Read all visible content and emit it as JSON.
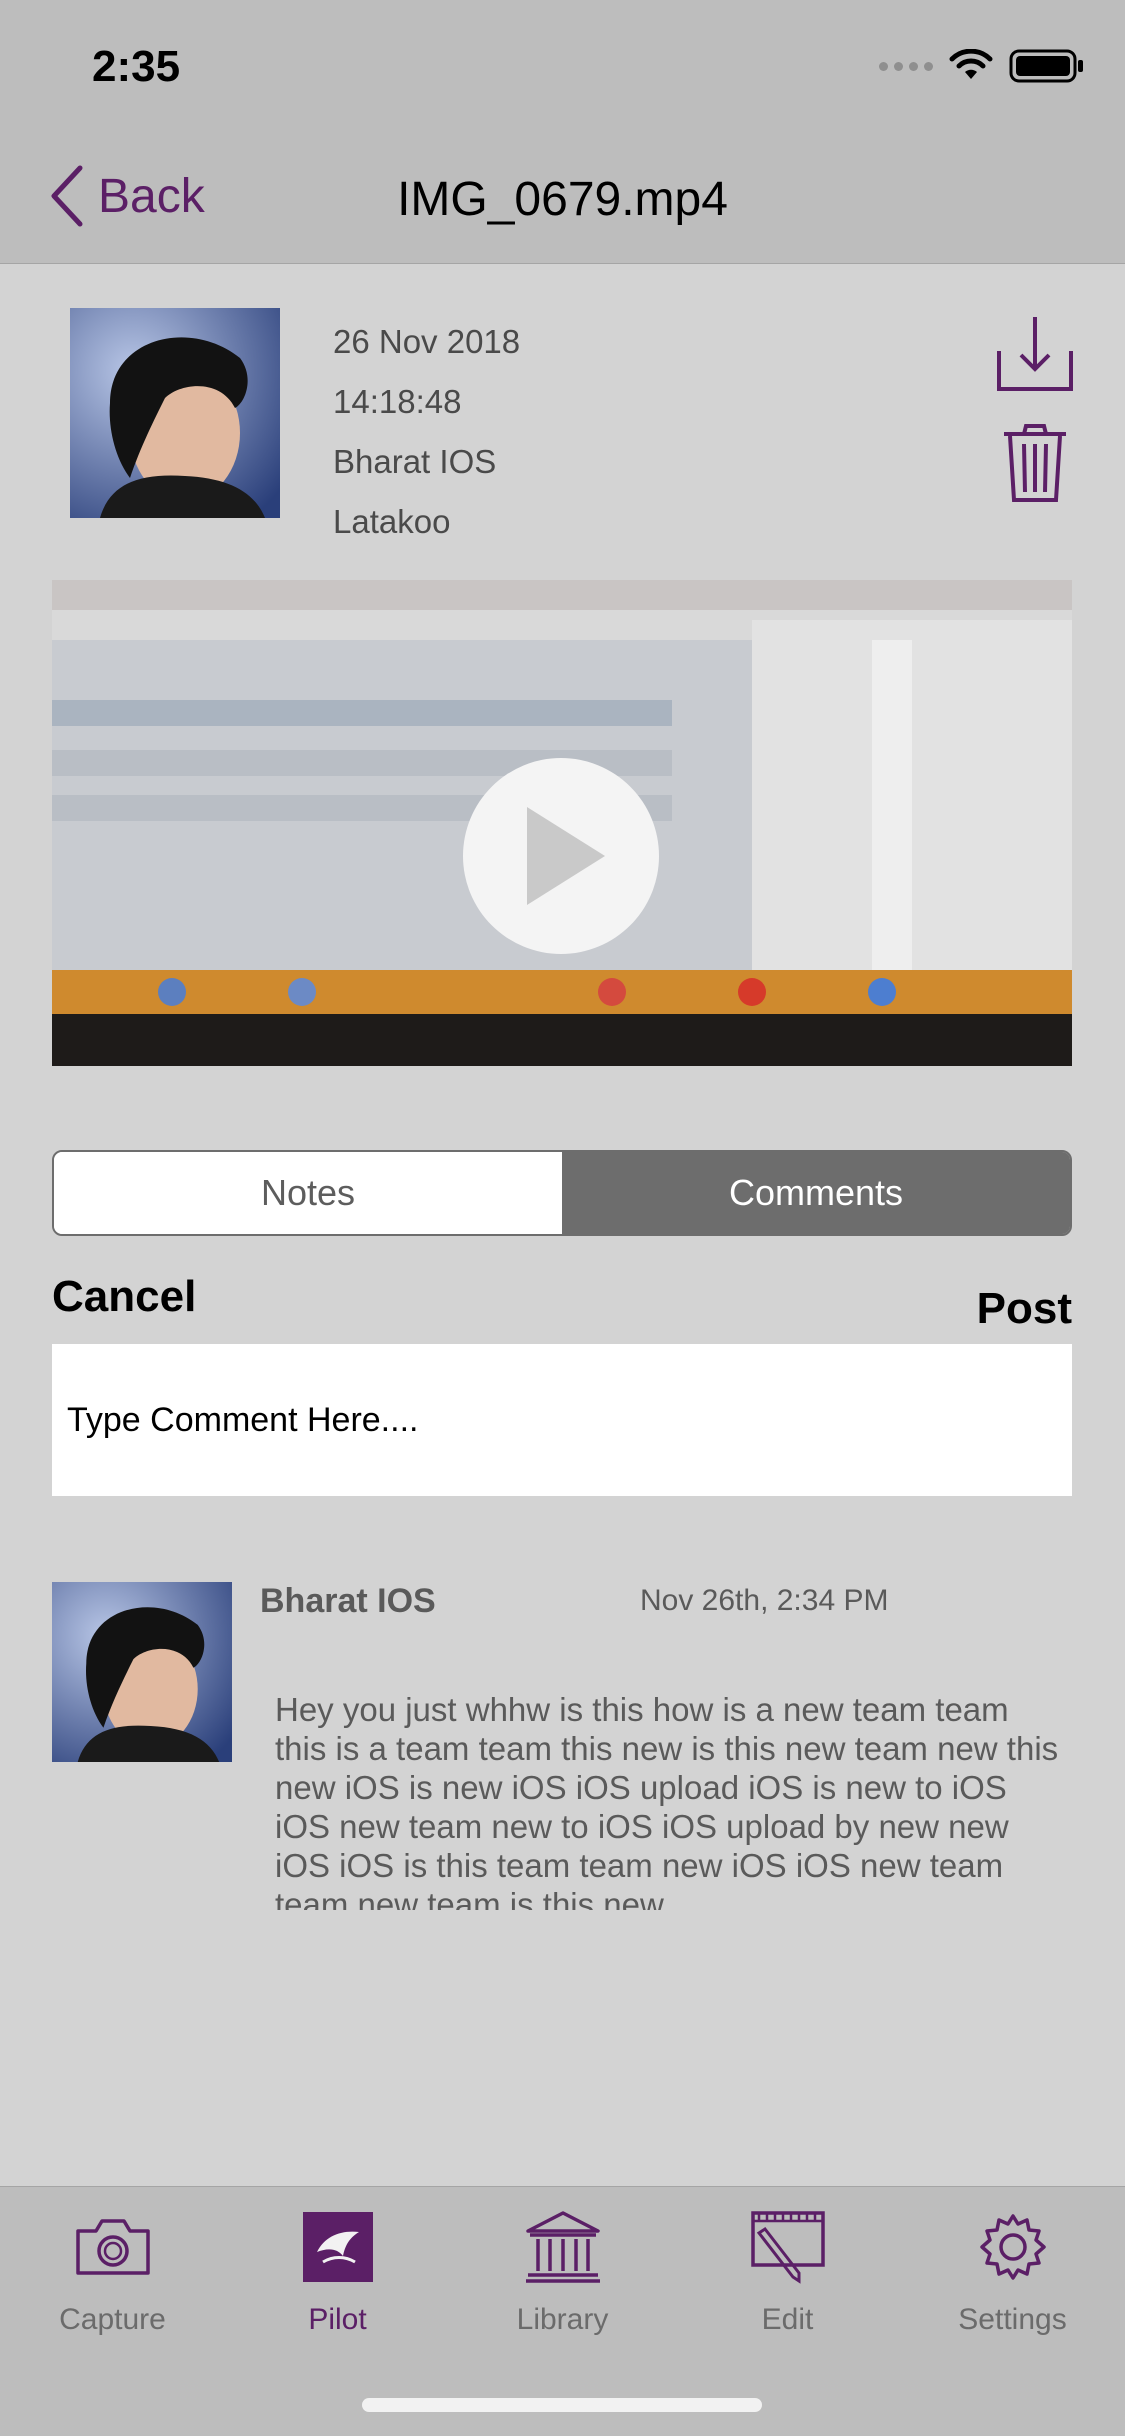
{
  "status_bar": {
    "time": "2:35"
  },
  "nav": {
    "back_label": "Back",
    "title": "IMG_0679.mp4"
  },
  "media_info": {
    "date": "26 Nov 2018",
    "time": "14:18:48",
    "author": "Bharat IOS",
    "organization": "Latakoo"
  },
  "tabs": {
    "notes": "Notes",
    "comments": "Comments",
    "selected": "comments"
  },
  "composer": {
    "cancel_label": "Cancel",
    "post_label": "Post",
    "placeholder": "Type Comment Here...."
  },
  "comments": [
    {
      "author": "Bharat IOS",
      "timestamp": "Nov 26th, 2:34 PM",
      "text": "Hey you just whhw is this how is a new team team this is a team team this new is this new team new this new iOS is new iOS iOS upload iOS is new to iOS iOS new team new to iOS iOS upload by new new iOS iOS is this team team new iOS iOS new team team new team is this new"
    }
  ],
  "tab_bar": {
    "items": [
      {
        "label": "Capture",
        "icon": "camera-icon"
      },
      {
        "label": "Pilot",
        "icon": "pilot-logo-icon",
        "active": true
      },
      {
        "label": "Library",
        "icon": "library-icon"
      },
      {
        "label": "Edit",
        "icon": "edit-film-icon"
      },
      {
        "label": "Settings",
        "icon": "gear-icon"
      }
    ]
  },
  "colors": {
    "accent": "#5b1f66",
    "background": "#d3d3d3",
    "bars": "#bdbdbd"
  }
}
